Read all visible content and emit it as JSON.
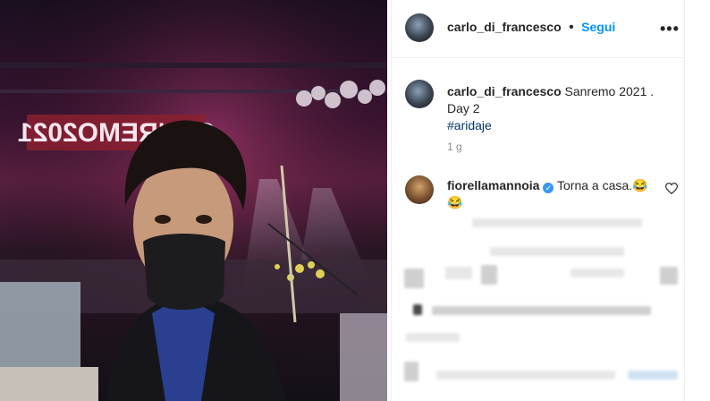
{
  "post": {
    "author": "carlo_di_francesco",
    "follow_label": "Segui",
    "more_label": "•••",
    "caption_text": "Sanremo 2021 . Day 2",
    "hashtag": "#aridaje",
    "time_ago": "1 g",
    "photo_sign_text": "SANREMO2021"
  },
  "comment": {
    "author": "fiorellamannoia",
    "text": "Torna a casa.😂😂",
    "verified": true
  },
  "colors": {
    "link_blue": "#0095f6",
    "verified_blue": "#3897f0",
    "hashtag": "#00376b",
    "text": "#262626",
    "muted": "#8e8e8e"
  },
  "icons": [
    "more-options-icon",
    "verified-badge-icon",
    "heart-icon"
  ]
}
